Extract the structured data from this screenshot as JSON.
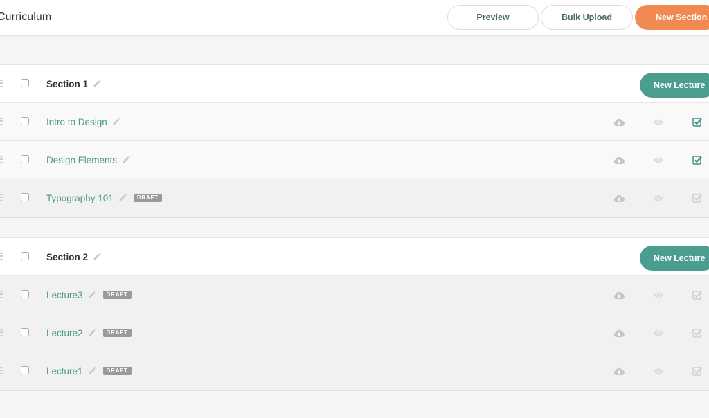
{
  "header": {
    "title": "Curriculum",
    "buttons": {
      "preview": "Preview",
      "bulk_upload": "Bulk Upload",
      "new_section": "New Section"
    }
  },
  "colors": {
    "accent_orange": "#f08a52",
    "accent_teal": "#4a9d8f",
    "lecture_link": "#4b9a8a",
    "draft_badge": "#9a9a9a"
  },
  "sections": [
    {
      "title": "Section 1",
      "new_lecture_label": "New Lecture",
      "lectures": [
        {
          "title": "Intro to Design",
          "draft": false,
          "badge": "",
          "published": true
        },
        {
          "title": "Design Elements",
          "draft": false,
          "badge": "",
          "published": true
        },
        {
          "title": "Typography 101",
          "draft": true,
          "badge": "DRAFT",
          "published": false
        }
      ]
    },
    {
      "title": "Section 2",
      "new_lecture_label": "New Lecture",
      "lectures": [
        {
          "title": "Lecture3",
          "draft": true,
          "badge": "DRAFT",
          "published": false
        },
        {
          "title": "Lecture2",
          "draft": true,
          "badge": "DRAFT",
          "published": false
        },
        {
          "title": "Lecture1",
          "draft": true,
          "badge": "DRAFT",
          "published": false
        }
      ]
    }
  ],
  "icons": {
    "drag": "drag-handle-icon",
    "edit": "pencil-icon",
    "download": "cloud-download-icon",
    "preview": "eye-icon",
    "publish": "checkbox-check-icon"
  }
}
